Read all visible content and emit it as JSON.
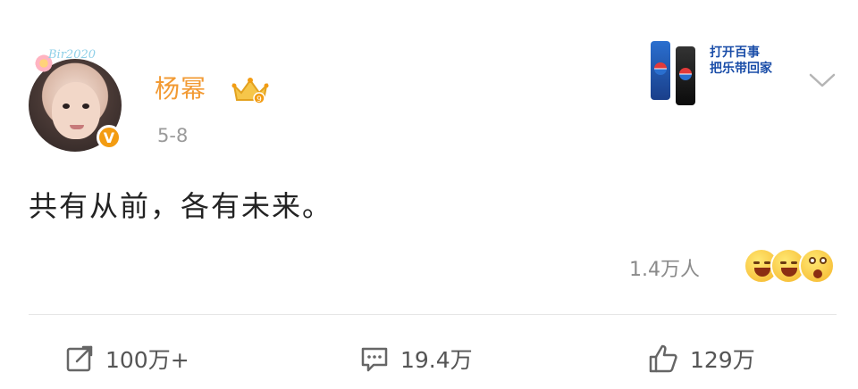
{
  "post": {
    "user": {
      "name": "杨幂",
      "avatar_frame_text": "Bir2020",
      "verified_badge": "V",
      "vip_icon": "crown-icon"
    },
    "date": "5-8",
    "text": "共有从前，各有未来。",
    "reactions": {
      "count_label": "1.4万人",
      "emoji_icons": [
        "grin-emoji-icon",
        "laugh-emoji-icon",
        "surprised-emoji-icon"
      ]
    },
    "actions": {
      "share": {
        "label": "100万+",
        "icon": "share-icon"
      },
      "comment": {
        "label": "19.4万",
        "icon": "comment-icon"
      },
      "like": {
        "label": "129万",
        "icon": "thumbs-up-icon"
      }
    }
  },
  "promo": {
    "line1": "打开百事",
    "line2": "把乐带回家",
    "icon": "pepsi-cans-icon"
  },
  "colors": {
    "username": "#f29a33",
    "verified": "#f39c12",
    "date": "#9a9a9a",
    "text": "#222222",
    "actions": "#555555"
  }
}
